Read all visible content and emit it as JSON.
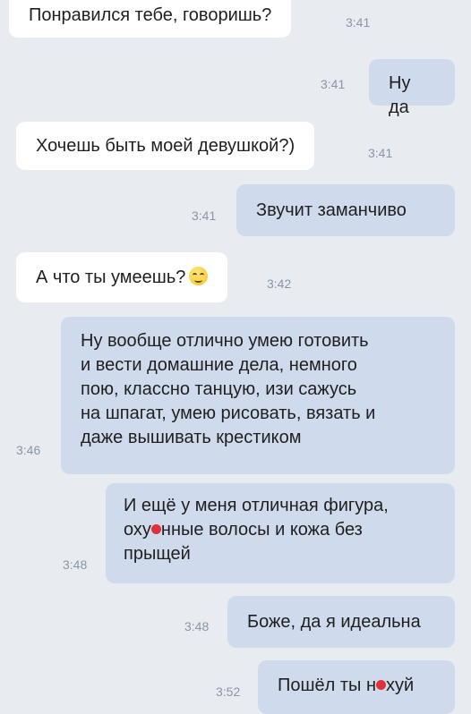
{
  "messages": [
    {
      "text": "Понравился тебе, говоришь?",
      "time": "3:41",
      "side": "in"
    },
    {
      "text": "Ну да",
      "time": "3:41",
      "side": "out"
    },
    {
      "text": "Хочешь быть моей девушкой?)",
      "time": "3:41",
      "side": "in"
    },
    {
      "text": "Звучит заманчиво",
      "time": "3:41",
      "side": "out"
    },
    {
      "text": "А что ты умеешь?",
      "time": "3:42",
      "side": "in",
      "emoji": "smirking-face"
    },
    {
      "lines": [
        "Ну вообще отлично умею готовить",
        "и вести домашние дела, немного",
        "пою, классно танцую, изи сажусь",
        "на шпагат, умею рисовать, вязать и",
        "даже вышивать крестиком"
      ],
      "time": "3:46",
      "side": "out"
    },
    {
      "lines": [
        "И ещё у меня отличная фигура,",
        "прыщей"
      ],
      "line2_before": "оху",
      "line2_after": "нные волосы и кожа без",
      "time": "3:48",
      "side": "out"
    },
    {
      "text": "Боже, да я идеальна",
      "time": "3:48",
      "side": "out"
    },
    {
      "text_before": "Пошёл ты н",
      "text_after": "хуй",
      "time": "3:52",
      "side": "out"
    }
  ],
  "colors": {
    "background": "#e8ecf1",
    "incoming": "#ffffff",
    "outgoing": "#cfdbec",
    "censor_dot": "#e0303a"
  }
}
